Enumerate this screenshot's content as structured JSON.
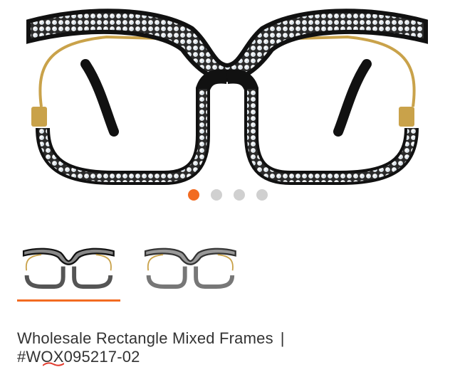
{
  "product": {
    "name": "Wholesale Rectangle Mixed Frames",
    "separator": "|",
    "sku": "#WOX095217-02"
  },
  "gallery": {
    "dots": [
      {
        "active": true
      },
      {
        "active": false
      },
      {
        "active": false
      },
      {
        "active": false
      }
    ],
    "thumbnails": [
      {
        "selected": true
      },
      {
        "selected": false
      }
    ]
  },
  "colors": {
    "accent": "#f26b21",
    "dot_inactive": "#d0d0d0",
    "frame": "#111111",
    "gold": "#c9a24a"
  }
}
